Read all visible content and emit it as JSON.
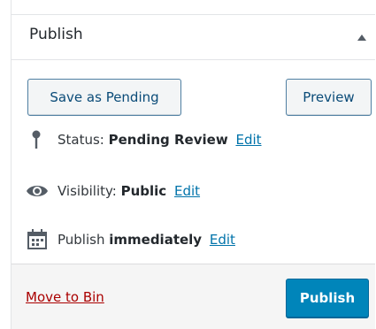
{
  "panel": {
    "title": "Publish",
    "toggle_icon": "triangle-up-icon"
  },
  "actions": {
    "save_pending_label": "Save as Pending",
    "preview_label": "Preview"
  },
  "status": {
    "icon": "pin-icon",
    "prefix": "Status:",
    "value": "Pending Review",
    "edit_label": "Edit"
  },
  "visibility": {
    "icon": "eye-icon",
    "prefix": "Visibility:",
    "value": "Public",
    "edit_label": "Edit"
  },
  "schedule": {
    "icon": "calendar-icon",
    "prefix": "Publish",
    "value": "immediately",
    "edit_label": "Edit"
  },
  "footer": {
    "trash_label": "Move to Bin",
    "publish_label": "Publish"
  },
  "colors": {
    "primary": "#0085ba",
    "link": "#0073aa",
    "danger": "#a00"
  }
}
